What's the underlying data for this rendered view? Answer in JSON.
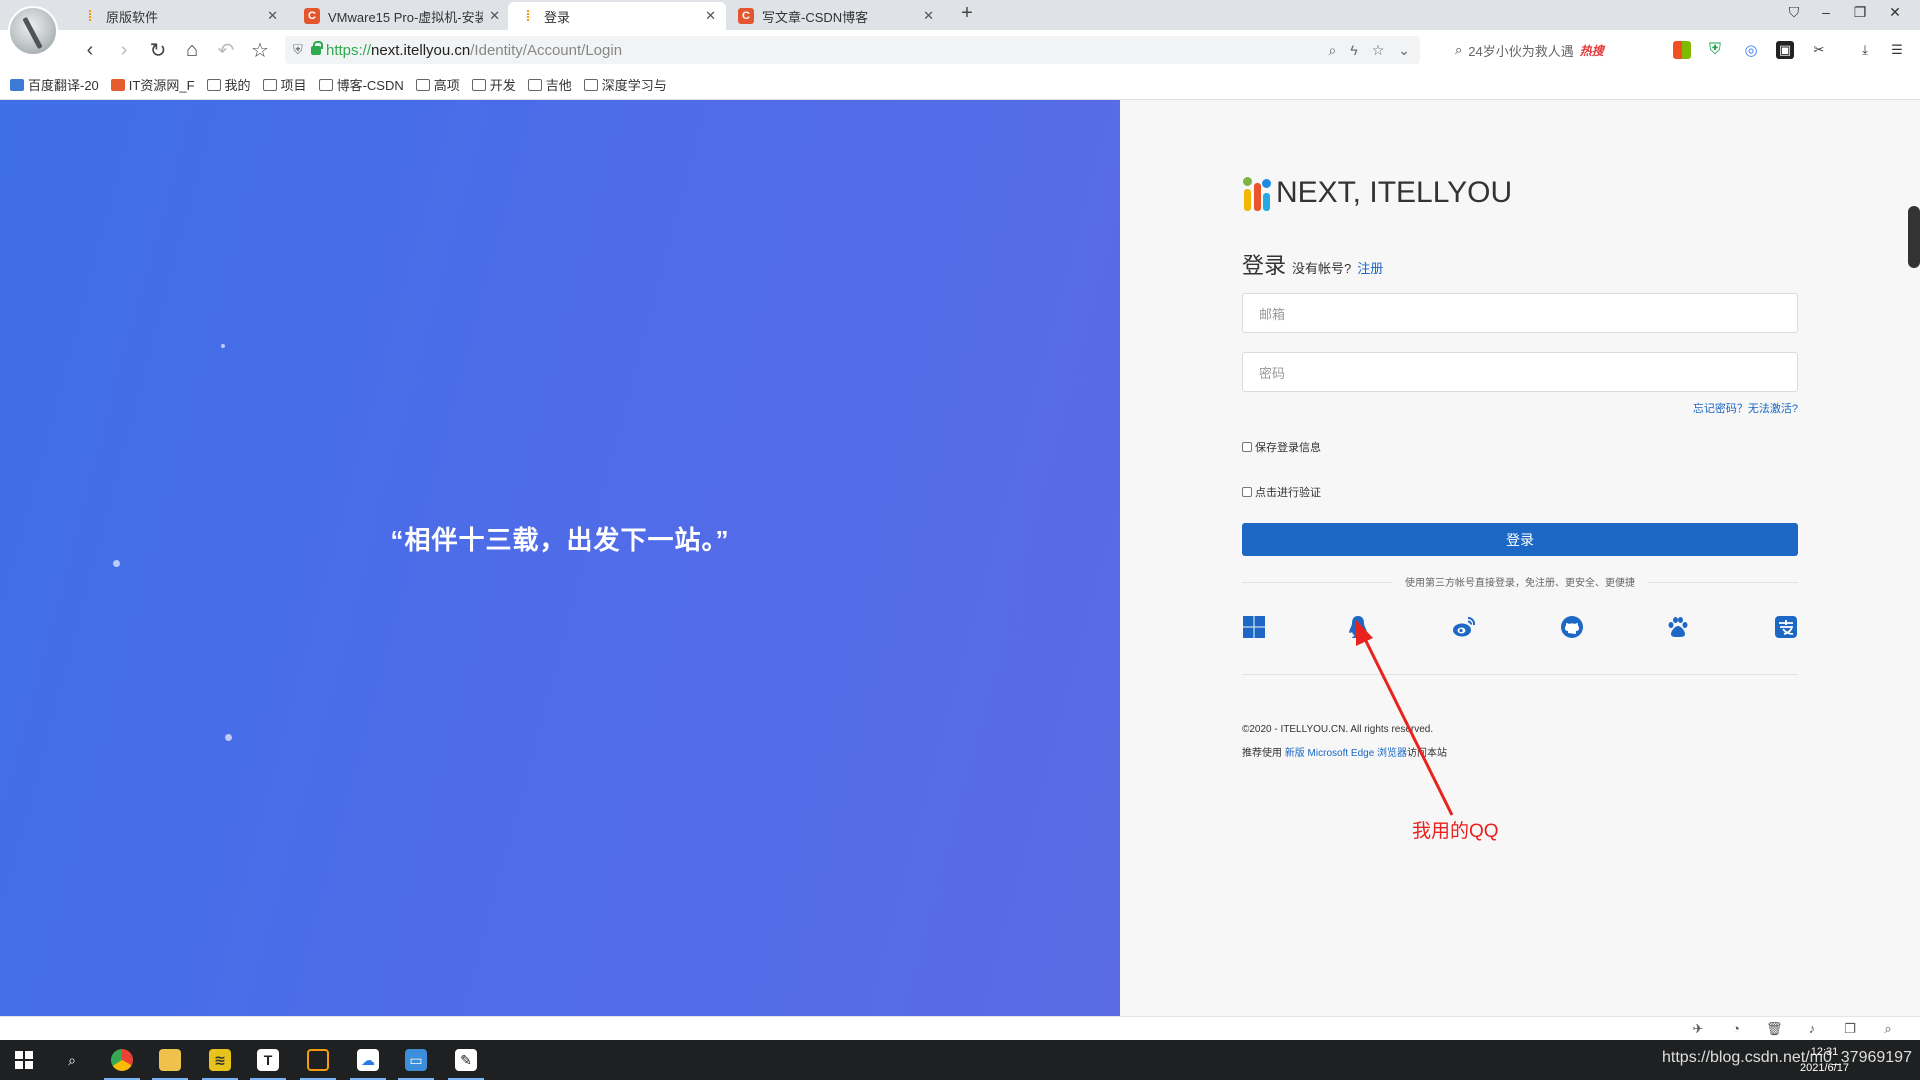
{
  "browser": {
    "tabs": [
      {
        "label": "原版软件",
        "icon": "itellyou-favicon"
      },
      {
        "label": "VMware15 Pro-虚拟机-安装",
        "icon": "csdn-favicon"
      },
      {
        "label": "登录",
        "icon": "itellyou-favicon"
      },
      {
        "label": "写文章-CSDN博客",
        "icon": "csdn-favicon"
      }
    ],
    "url": {
      "scheme": "https://",
      "host": "next.itellyou.cn",
      "path": "/Identity/Account/Login"
    },
    "search": {
      "text": "24岁小伙为救人遇",
      "hot_badge": "热搜"
    },
    "bookmarks": [
      {
        "label": "百度翻译-20",
        "icon": "baidu-translate-favicon"
      },
      {
        "label": "IT资源网_F",
        "icon": "it-resource-favicon"
      },
      {
        "label": "我的",
        "icon": "folder-icon"
      },
      {
        "label": "项目",
        "icon": "folder-icon"
      },
      {
        "label": "博客-CSDN",
        "icon": "folder-icon"
      },
      {
        "label": "高项",
        "icon": "folder-icon"
      },
      {
        "label": "开发",
        "icon": "folder-icon"
      },
      {
        "label": "吉他",
        "icon": "folder-icon"
      },
      {
        "label": "深度学习与",
        "icon": "folder-icon"
      }
    ]
  },
  "hero": {
    "quote": "“相伴十三载，出发下一站。”"
  },
  "login": {
    "brand": "NEXT, ITELLYOU",
    "title": "登录",
    "no_account": "没有帐号?",
    "register_link": "注册",
    "email_placeholder": "邮箱",
    "password_placeholder": "密码",
    "forgot_link": "忘记密码？无法激活?",
    "remember_label": "保存登录信息",
    "verify_label": "点击进行验证",
    "submit_label": "登录",
    "third_party_text": "使用第三方帐号直接登录，免注册、更安全、更便捷",
    "social": [
      {
        "name": "microsoft",
        "icon": "windows-icon"
      },
      {
        "name": "qq",
        "icon": "qq-penguin-icon"
      },
      {
        "name": "weibo",
        "icon": "weibo-icon"
      },
      {
        "name": "github",
        "icon": "github-icon"
      },
      {
        "name": "baidu",
        "icon": "baidu-paw-icon"
      },
      {
        "name": "alipay",
        "icon": "alipay-icon"
      }
    ],
    "copyright": "©2020 - ITELLYOU.CN. All rights reserved.",
    "recommend_prefix": "推荐使用",
    "recommend_link": "新版 Microsoft Edge 浏览器",
    "recommend_suffix": "访问本站"
  },
  "annotation": {
    "text": "我用的QQ",
    "color": "#e8231f"
  },
  "taskbar": {
    "time": "12:31",
    "date": "2021/6/17",
    "watermark": "https://blog.csdn.net/m0_37969197"
  },
  "colors": {
    "hero_start": "#3e6ee8",
    "hero_end": "#5b6be6",
    "primary": "#1d68c4"
  }
}
